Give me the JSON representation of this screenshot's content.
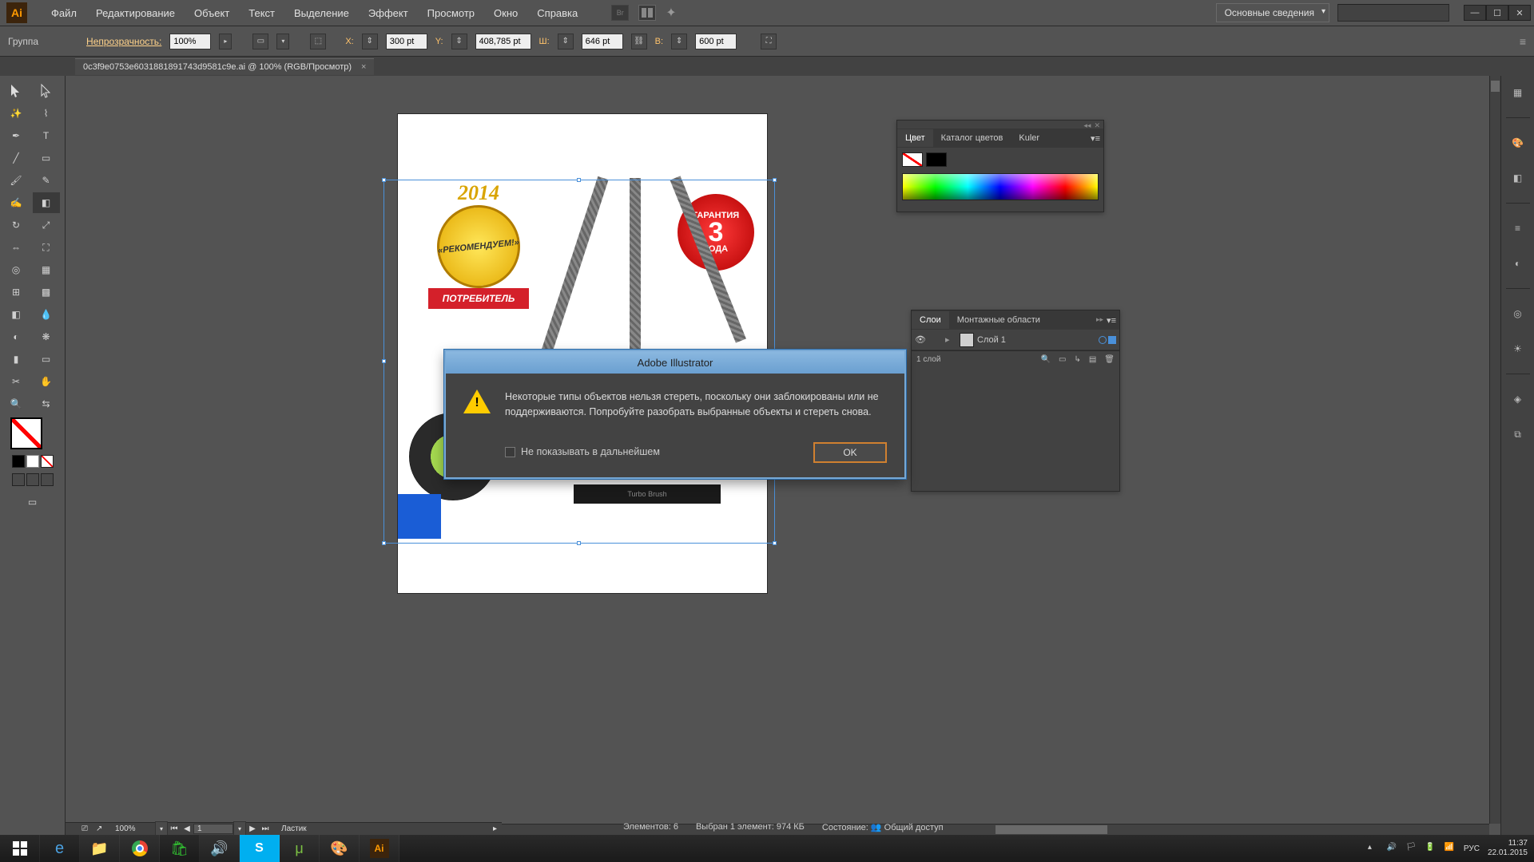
{
  "menubar": {
    "items": [
      "Файл",
      "Редактирование",
      "Объект",
      "Текст",
      "Выделение",
      "Эффект",
      "Просмотр",
      "Окно",
      "Справка"
    ],
    "workspace": "Основные сведения"
  },
  "controlbar": {
    "selection": "Группа",
    "opacity_label": "Непрозрачность:",
    "opacity_value": "100%",
    "x_label": "X:",
    "x_value": "300 pt",
    "y_label": "Y:",
    "y_value": "408,785 pt",
    "w_label": "Ш:",
    "w_value": "646 pt",
    "h_label": "В:",
    "h_value": "600 pt"
  },
  "doctab": {
    "title": "0c3f9e0753e6031881891743d9581c9e.ai @ 100% (RGB/Просмотр)"
  },
  "bottom": {
    "zoom": "100%",
    "artboard": "1",
    "tool": "Ластик"
  },
  "status": {
    "elements": "Элементов: 6",
    "selected": "Выбран 1 элемент: 974 КБ",
    "state_label": "Состояние:",
    "state_value": "Общий доступ"
  },
  "color_panel": {
    "tabs": [
      "Цвет",
      "Каталог цветов",
      "Kuler"
    ]
  },
  "layers_panel": {
    "tabs": [
      "Слои",
      "Монтажные области"
    ],
    "layer_name": "Слой 1",
    "footer": "1 слой"
  },
  "dialog": {
    "title": "Adobe Illustrator",
    "message": "Некоторые типы объектов нельзя стереть, поскольку они заблокированы или не поддерживаются. Попробуйте разобрать выбранные объекты и стереть снова.",
    "checkbox": "Не показывать в дальнейшем",
    "ok": "OK"
  },
  "artwork": {
    "year": "2014",
    "recommend": "«РЕКОМЕНДУЕМ!»",
    "consumer": "ПОТРЕБИТЕЛЬ",
    "warranty_top": "ГАРАНТИЯ",
    "warranty_num": "3",
    "warranty_bot": "ГОДА",
    "brush": "Turbo Brush"
  },
  "taskbar": {
    "lang": "РУС",
    "time": "11:37",
    "date": "22.01.2015"
  }
}
